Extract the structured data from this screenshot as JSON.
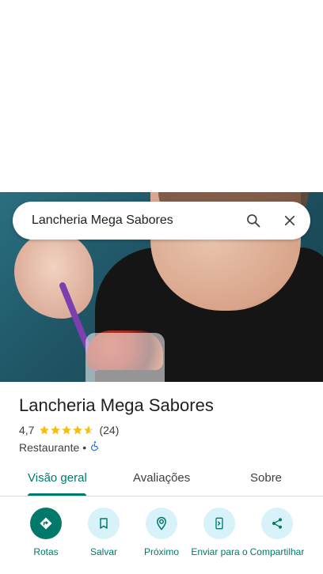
{
  "search": {
    "value": "Lancheria Mega Sabores"
  },
  "place": {
    "title": "Lancheria Mega Sabores",
    "rating": "4,7",
    "rating_value": 4.7,
    "review_count": "(24)",
    "category": "Restaurante",
    "separator": "•"
  },
  "tabs": [
    {
      "label": "Visão geral",
      "active": true
    },
    {
      "label": "Avaliações",
      "active": false
    },
    {
      "label": "Sobre",
      "active": false
    }
  ],
  "actions": [
    {
      "label": "Rotas",
      "icon": "directions-icon"
    },
    {
      "label": "Salvar",
      "icon": "bookmark-icon"
    },
    {
      "label": "Próximo",
      "icon": "nearby-icon"
    },
    {
      "label": "Enviar para o",
      "icon": "send-to-phone-icon"
    },
    {
      "label": "Compartilhar",
      "icon": "share-icon"
    }
  ],
  "colors": {
    "accent": "#00796b",
    "action_bg": "#d7f2f8",
    "star": "#fbbc04"
  }
}
